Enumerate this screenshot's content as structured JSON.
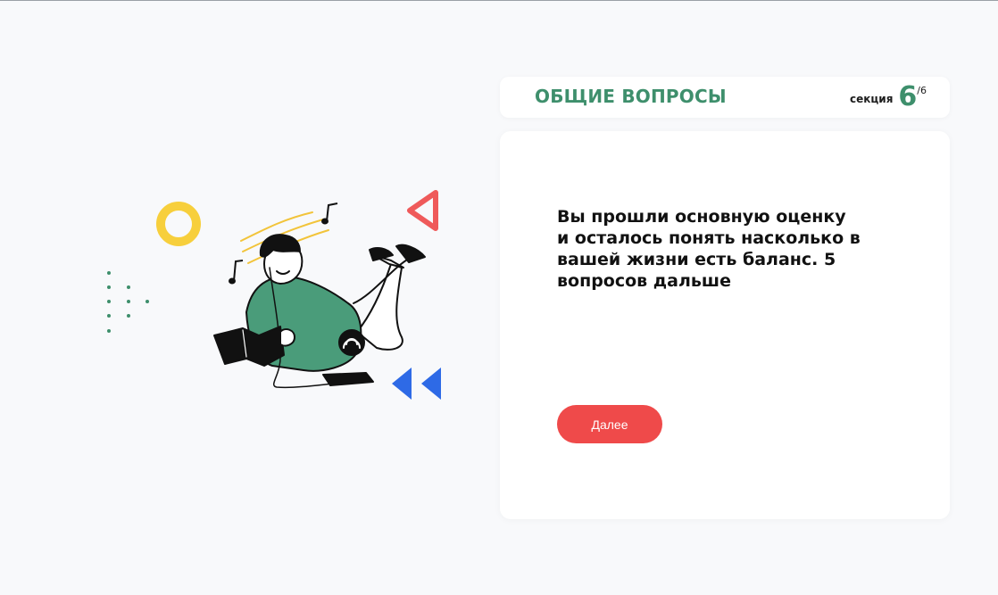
{
  "header": {
    "section_title": "ОБЩИЕ ВОПРОСЫ",
    "section_label": "секция",
    "section_current": "6",
    "section_total": "/6"
  },
  "main": {
    "message": "Вы прошли основную оценку и осталось понять насколько в вашей жизни есть баланс. 5 вопросов дальше",
    "next_button_label": "Далее"
  },
  "illustration": {
    "subject": "man-reading-book-with-headphones-icon",
    "decorations": [
      "yellow-ring-icon",
      "red-triangle-icon",
      "blue-double-triangle-icon",
      "green-dots-icon",
      "music-note-icon"
    ]
  },
  "colors": {
    "accent_green": "#3e8f6c",
    "button_red": "#ef4a4a",
    "ring_yellow": "#f7cf3c",
    "triangle_red": "#ef5a5a",
    "triangle_blue": "#2e6ae6",
    "background": "#f8f9fb"
  }
}
